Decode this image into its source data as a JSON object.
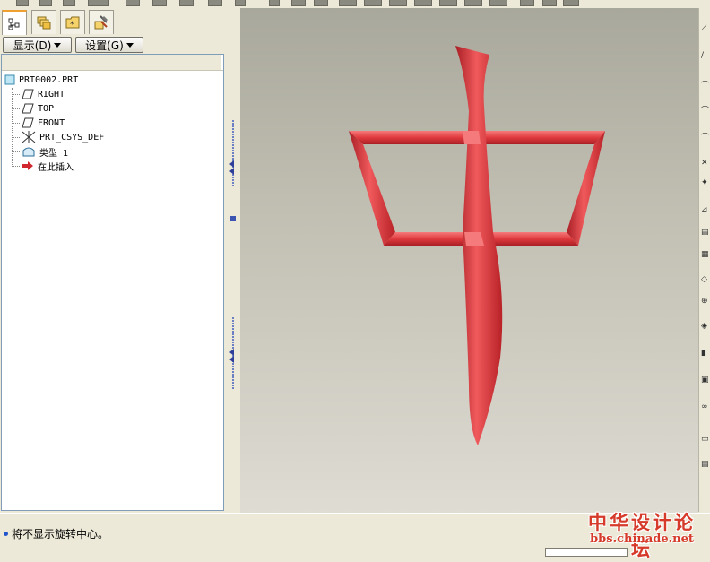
{
  "toolbar": {
    "icons": [
      "toolbar-button-icon"
    ]
  },
  "nav_tabs": [
    {
      "name": "model-tree-tab",
      "icon": "model-tree-icon",
      "active": true
    },
    {
      "name": "layer-tree-tab",
      "icon": "folder-layers-icon",
      "active": false
    },
    {
      "name": "favorites-tab",
      "icon": "star-folder-icon",
      "active": false
    },
    {
      "name": "tools-tab",
      "icon": "hammer-wrench-icon",
      "active": false
    }
  ],
  "buttons": {
    "display_label": "显示(D)",
    "settings_label": "设置(G)"
  },
  "tree": {
    "root": "PRT0002.PRT",
    "items": [
      {
        "label": "RIGHT",
        "icon": "datum-plane-icon"
      },
      {
        "label": "TOP",
        "icon": "datum-plane-icon"
      },
      {
        "label": "FRONT",
        "icon": "datum-plane-icon"
      },
      {
        "label": "PRT_CSYS_DEF",
        "icon": "coordinate-system-icon"
      },
      {
        "label": "类型 1",
        "icon": "feature-icon"
      },
      {
        "label": "在此插入",
        "icon": "insert-here-arrow-icon"
      }
    ]
  },
  "status": {
    "message": "将不显示旋转中心。"
  },
  "watermark": {
    "title": "中华设计论坛",
    "url": "bbs.chinade.net"
  },
  "colors": {
    "model_red": "#e0393d",
    "selection_blue": "#2255cc"
  }
}
